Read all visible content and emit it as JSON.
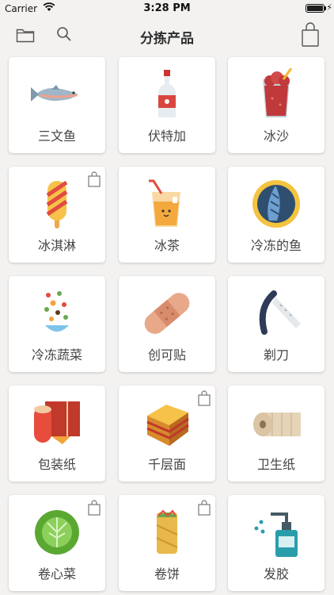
{
  "status": {
    "carrier": "Carrier",
    "time": "3:28 PM"
  },
  "nav": {
    "title": "分拣产品"
  },
  "items": [
    {
      "label": "三文鱼",
      "icon": "salmon-icon",
      "badge": false
    },
    {
      "label": "伏特加",
      "icon": "vodka-icon",
      "badge": false
    },
    {
      "label": "冰沙",
      "icon": "smoothie-icon",
      "badge": false
    },
    {
      "label": "冰淇淋",
      "icon": "ice-cream-icon",
      "badge": true
    },
    {
      "label": "冰茶",
      "icon": "iced-tea-icon",
      "badge": false
    },
    {
      "label": "冷冻的鱼",
      "icon": "frozen-fish-icon",
      "badge": false
    },
    {
      "label": "冷冻蔬菜",
      "icon": "frozen-vegetables-icon",
      "badge": false
    },
    {
      "label": "创可贴",
      "icon": "bandage-icon",
      "badge": false
    },
    {
      "label": "剃刀",
      "icon": "razor-icon",
      "badge": false
    },
    {
      "label": "包装纸",
      "icon": "wrapping-paper-icon",
      "badge": false
    },
    {
      "label": "千层面",
      "icon": "lasagna-icon",
      "badge": true
    },
    {
      "label": "卫生纸",
      "icon": "toilet-paper-icon",
      "badge": false
    },
    {
      "label": "卷心菜",
      "icon": "cabbage-icon",
      "badge": true
    },
    {
      "label": "卷饼",
      "icon": "burrito-icon",
      "badge": true
    },
    {
      "label": "发胶",
      "icon": "hair-gel-icon",
      "badge": false
    }
  ]
}
